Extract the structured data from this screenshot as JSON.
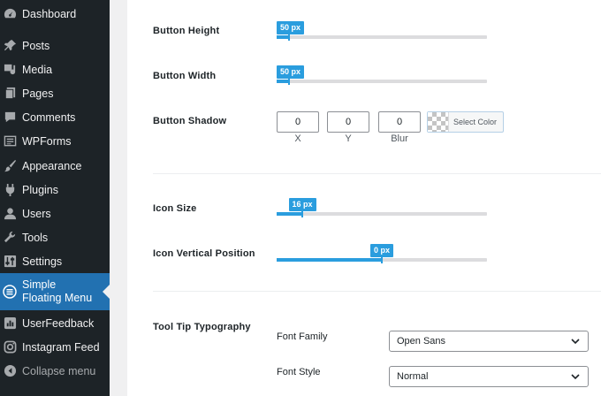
{
  "sidebar": {
    "items": [
      {
        "label": "Dashboard",
        "icon": "dashboard-icon"
      },
      {
        "label": "Posts",
        "icon": "pin-icon"
      },
      {
        "label": "Media",
        "icon": "media-icon"
      },
      {
        "label": "Pages",
        "icon": "pages-icon"
      },
      {
        "label": "Comments",
        "icon": "comment-icon"
      },
      {
        "label": "WPForms",
        "icon": "forms-icon"
      },
      {
        "label": "Appearance",
        "icon": "brush-icon"
      },
      {
        "label": "Plugins",
        "icon": "plugin-icon"
      },
      {
        "label": "Users",
        "icon": "user-icon"
      },
      {
        "label": "Tools",
        "icon": "wrench-icon"
      },
      {
        "label": "Settings",
        "icon": "settings-icon"
      },
      {
        "label": "Simple Floating Menu",
        "icon": "menu-list-icon",
        "active": true
      },
      {
        "label": "UserFeedback",
        "icon": "feedback-icon"
      },
      {
        "label": "Instagram Feed",
        "icon": "instagram-icon"
      },
      {
        "label": "Collapse menu",
        "icon": "collapse-icon"
      }
    ],
    "colors": {
      "background": "#1d2327",
      "active": "#2271b1",
      "text": "#f0f0f1"
    }
  },
  "settings": {
    "button_height": {
      "label": "Button Height",
      "value_text": "50 px",
      "fraction": 0.06
    },
    "button_width": {
      "label": "Button Width",
      "value_text": "50 px",
      "fraction": 0.06
    },
    "button_shadow": {
      "label": "Button Shadow",
      "x": {
        "value": "0",
        "caption": "X"
      },
      "y": {
        "value": "0",
        "caption": "Y"
      },
      "blur": {
        "value": "0",
        "caption": "Blur"
      },
      "color_button": "Select Color"
    },
    "icon_size": {
      "label": "Icon Size",
      "value_text": "16 px",
      "fraction": 0.12
    },
    "icon_vertical_position": {
      "label": "Icon Vertical Position",
      "value_text": "0 px",
      "fraction": 0.5
    },
    "tooltip_typography": {
      "label": "Tool Tip Typography",
      "font_family": {
        "label": "Font Family",
        "value": "Open Sans"
      },
      "font_style": {
        "label": "Font Style",
        "value": "Normal"
      }
    },
    "accent_color": "#2a9dde"
  }
}
